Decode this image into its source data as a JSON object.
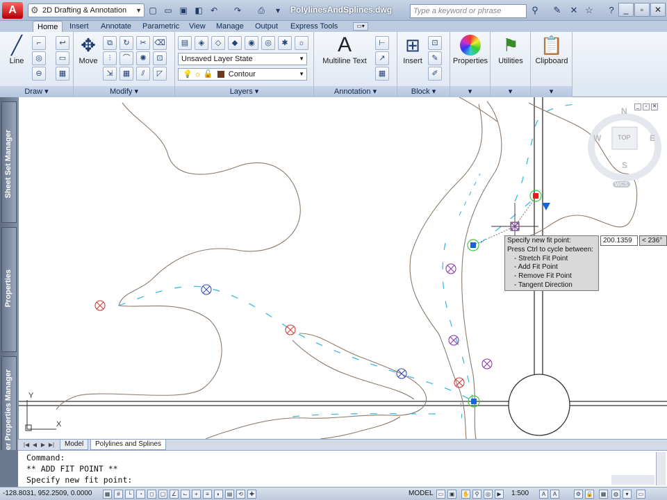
{
  "titlebar": {
    "app_letter": "A",
    "workspace": "2D Drafting & Annotation",
    "document": "PolylinesAndSplines.dwg",
    "search_placeholder": "Type a keyword or phrase"
  },
  "tabs": [
    "Home",
    "Insert",
    "Annotate",
    "Parametric",
    "View",
    "Manage",
    "Output",
    "Express Tools"
  ],
  "active_tab": "Home",
  "ribbon": {
    "draw": {
      "title": "Draw",
      "line": "Line"
    },
    "modify": {
      "title": "Modify",
      "move": "Move"
    },
    "layers": {
      "title": "Layers",
      "layer_state": "Unsaved Layer State",
      "current_layer": "Contour"
    },
    "annotation": {
      "title": "Annotation",
      "mtext": "Multiline Text"
    },
    "block": {
      "title": "Block",
      "insert": "Insert"
    },
    "properties": {
      "label": "Properties"
    },
    "utilities": {
      "label": "Utilities"
    },
    "clipboard": {
      "label": "Clipboard"
    }
  },
  "palettes": [
    "Sheet Set Manager",
    "Properties",
    "Layer Properties Manager"
  ],
  "viewcube": {
    "north": "N",
    "south": "S",
    "east": "E",
    "west": "W",
    "face": "TOP",
    "ucs": "WCS"
  },
  "ucs_icon": {
    "x": "X",
    "y": "Y"
  },
  "tooltip": {
    "title": "Specify new fit point:",
    "hint": "Press Ctrl to cycle between:",
    "items": [
      "Stretch Fit Point",
      "Add Fit Point",
      "Remove Fit Point",
      "Tangent Direction"
    ]
  },
  "dynamic_input": {
    "distance": "200.1359",
    "angle": "< 236°"
  },
  "layout_tabs": [
    "Model",
    "Polylines and Splines"
  ],
  "active_layout": "Polylines and Splines",
  "command_line": [
    "Command:",
    "** ADD FIT POINT **",
    "Specify new fit point:"
  ],
  "status": {
    "coords": "-128.8031, 952.2509, 0.0000",
    "space": "MODEL",
    "scale": "1:500"
  },
  "colors": {
    "contour": "#8c7a6a",
    "spline": "#2ab6e6",
    "fitpoint_red": "#d23a3a",
    "fitpoint_blue": "#3a4fb8",
    "fitpoint_purple": "#8a3aa8",
    "grip_green": "#3ec83e",
    "grip_blue": "#1565d8",
    "road": "#333333"
  }
}
